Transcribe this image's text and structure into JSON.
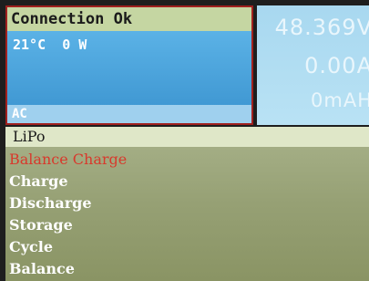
{
  "status": {
    "connection": "Connection Ok",
    "temperature": "21°C",
    "power": "0 W",
    "mode": "AC"
  },
  "readouts": {
    "voltage": "48.369V",
    "current": "0.00A",
    "capacity": "0mAH"
  },
  "menu": {
    "battery_type": "LiPo",
    "items": [
      {
        "label": "Balance Charge",
        "selected": true
      },
      {
        "label": "Charge",
        "selected": false
      },
      {
        "label": "Discharge",
        "selected": false
      },
      {
        "label": "Storage",
        "selected": false
      },
      {
        "label": "Cycle",
        "selected": false
      },
      {
        "label": "Balance",
        "selected": false
      }
    ]
  },
  "colors": {
    "selected_item": "#d8392c",
    "normal_item": "#ffffff",
    "status_border": "#a0201e"
  }
}
